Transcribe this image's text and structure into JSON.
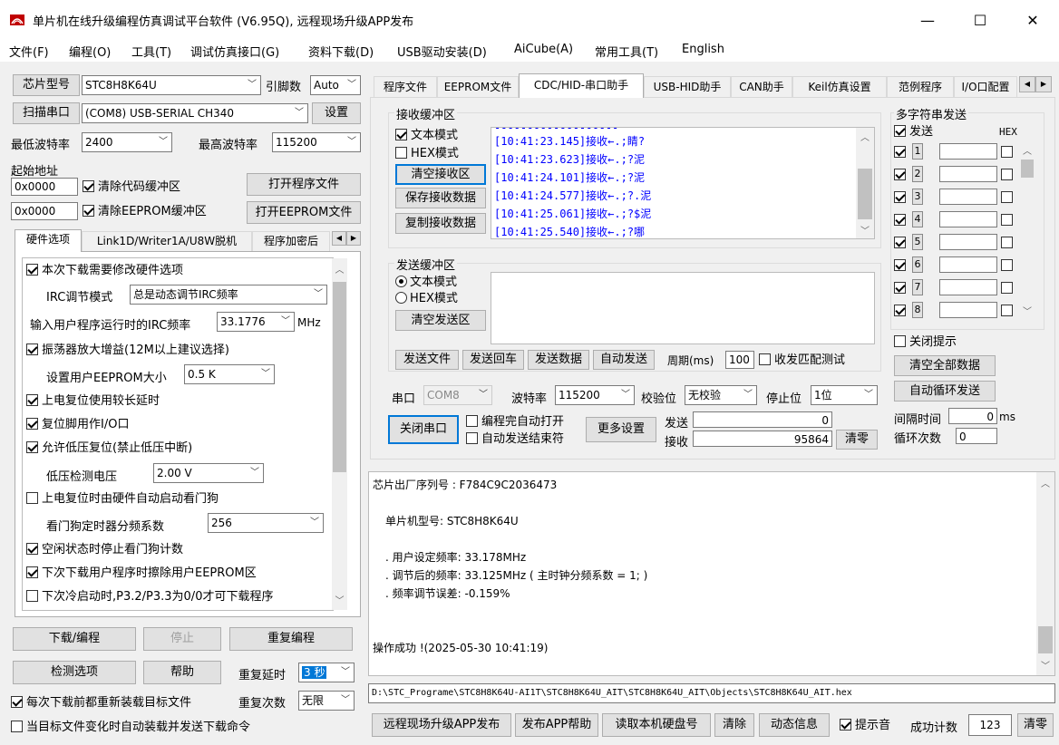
{
  "window": {
    "title": "单片机在线升级编程仿真调试平台软件 (V6.95Q), 远程现场升级APP发布",
    "minimize": "—",
    "maximize": "☐",
    "close": "✕",
    "icon": "app-logo-icon"
  },
  "menu": [
    "文件(F)",
    "编程(O)",
    "工具(T)",
    "调试仿真接口(G)",
    "资料下载(D)",
    "USB驱动安装(D)",
    "AiCube(A)",
    "常用工具(T)",
    "English"
  ],
  "left": {
    "chip_label": "芯片型号",
    "chip_value": "STC8H8K64U",
    "pin_label": "引脚数",
    "pin_value": "Auto",
    "scan_button": "扫描串口",
    "port_value": "(COM8) USB-SERIAL CH340",
    "settings_button": "设置",
    "min_baud_label": "最低波特率",
    "min_baud_value": "2400",
    "max_baud_label": "最高波特率",
    "max_baud_value": "115200",
    "start_addr_label": "起始地址",
    "addr1": "0x0000",
    "clear_code_label": "清除代码缓冲区",
    "open_program_button": "打开程序文件",
    "addr2": "0x0000",
    "clear_eeprom_label": "清除EEPROM缓冲区",
    "open_eeprom_button": "打开EEPROM文件",
    "tabs": [
      "硬件选项",
      "Link1D/Writer1A/U8W脱机",
      "程序加密后"
    ],
    "hw": {
      "modify_hw": "本次下载需要修改硬件选项",
      "irc_mode_label": "IRC调节模式",
      "irc_mode_value": "总是动态调节IRC频率",
      "irc_freq_label": "输入用户程序运行时的IRC频率",
      "irc_freq_value": "33.1776",
      "irc_freq_unit": "MHz",
      "osc_gain": "振荡器放大增益(12M以上建议选择)",
      "eeprom_size_label": "设置用户EEPROM大小",
      "eeprom_size_value": "0.5 K",
      "long_delay": "上电复位使用较长延时",
      "reset_io": "复位脚用作I/O口",
      "lvr": "允许低压复位(禁止低压中断)",
      "lvd_label": "低压检测电压",
      "lvd_value": "2.00 V",
      "wdt_auto": "上电复位时由硬件自动启动看门狗",
      "wdt_div_label": "看门狗定时器分频系数",
      "wdt_div_value": "256",
      "idle_stop_wdt": "空闲状态时停止看门狗计数",
      "erase_eeprom": "下次下载用户程序时擦除用户EEPROM区",
      "cold_boot": "下次冷启动时,P3.2/P3.3为0/0才可下载程序"
    },
    "download_button": "下载/编程",
    "stop_button": "停止",
    "reprogram_button": "重复编程",
    "detect_button": "检测选项",
    "help_button": "帮助",
    "repeat_delay_label": "重复延时",
    "repeat_delay_value": "3 秒",
    "repeat_count_label": "重复次数",
    "repeat_count_value": "无限",
    "reload_each": "每次下载前都重新装载目标文件",
    "auto_load": "当目标文件变化时自动装载并发送下载命令"
  },
  "right": {
    "tabs": [
      "程序文件",
      "EEPROM文件",
      "CDC/HID-串口助手",
      "USB-HID助手",
      "CAN助手",
      "Keil仿真设置",
      "范例程序",
      "I/O口配置"
    ],
    "rx": {
      "title": "接收缓冲区",
      "text_mode": "文本模式",
      "hex_mode": "HEX模式",
      "clear_button": "清空接收区",
      "save_button": "保存接收数据",
      "copy_button": "复制接收数据",
      "lines": [
        "[10:41:23.145]接收←.;睛?",
        "[10:41:23.623]接收←.;?泥",
        "[10:41:24.101]接收←.;?泥",
        "[10:41:24.577]接收←.;?.泥",
        "[10:41:25.061]接收←.;?$泥",
        "[10:41:25.540]接收←.;?哪"
      ]
    },
    "tx": {
      "title": "发送缓冲区",
      "text_mode": "文本模式",
      "hex_mode": "HEX模式",
      "clear_button": "清空发送区",
      "send_file": "发送文件",
      "send_enter": "发送回车",
      "send_data": "发送数据",
      "auto_send": "自动发送",
      "period_label": "周期(ms)",
      "period_value": "100",
      "match_test": "收发匹配测试"
    },
    "serial": {
      "port_label": "串口",
      "port_value": "COM8",
      "baud_label": "波特率",
      "baud_value": "115200",
      "parity_label": "校验位",
      "parity_value": "无校验",
      "stop_label": "停止位",
      "stop_value": "1位",
      "close_button": "关闭串口",
      "auto_open": "编程完自动打开",
      "auto_end": "自动发送结束符",
      "more_button": "更多设置",
      "send_label": "发送",
      "send_count": "0",
      "recv_label": "接收",
      "recv_count": "95864",
      "zero_button": "清零"
    },
    "multi": {
      "title": "多字符串发送",
      "send_col": "发送",
      "hex_col": "HEX",
      "rows": [
        "1",
        "2",
        "3",
        "4",
        "5",
        "6",
        "7",
        "8"
      ],
      "close_tip": "关闭提示",
      "clear_all": "清空全部数据",
      "auto_loop": "自动循环发送",
      "interval_label": "间隔时间",
      "interval_value": "0",
      "interval_unit": "ms",
      "loop_label": "循环次数",
      "loop_value": "0"
    },
    "output": {
      "lines": [
        "芯片出厂序列号 : F784C9C2036473",
        "单片机型号: STC8H8K64U",
        ". 用户设定频率: 33.178MHz",
        ". 调节后的频率: 33.125MHz ( 主时钟分频系数 = 1; )",
        ". 频率调节误差: -0.159%",
        "操作成功 !(2025-05-30 10:41:19)"
      ]
    },
    "filepath": "D:\\STC_Programe\\STC8H8K64U-AI1T\\STC8H8K64U_AIT\\STC8H8K64U_AIT\\Objects\\STC8H8K64U_AIT.hex",
    "bottom": {
      "remote_publish": "远程现场升级APP发布",
      "publish_help": "发布APP帮助",
      "read_disk": "读取本机硬盘号",
      "clear": "清除",
      "dynamic_info": "动态信息",
      "beep": "提示音",
      "success_label": "成功计数",
      "success_value": "123",
      "zero": "清零"
    }
  }
}
